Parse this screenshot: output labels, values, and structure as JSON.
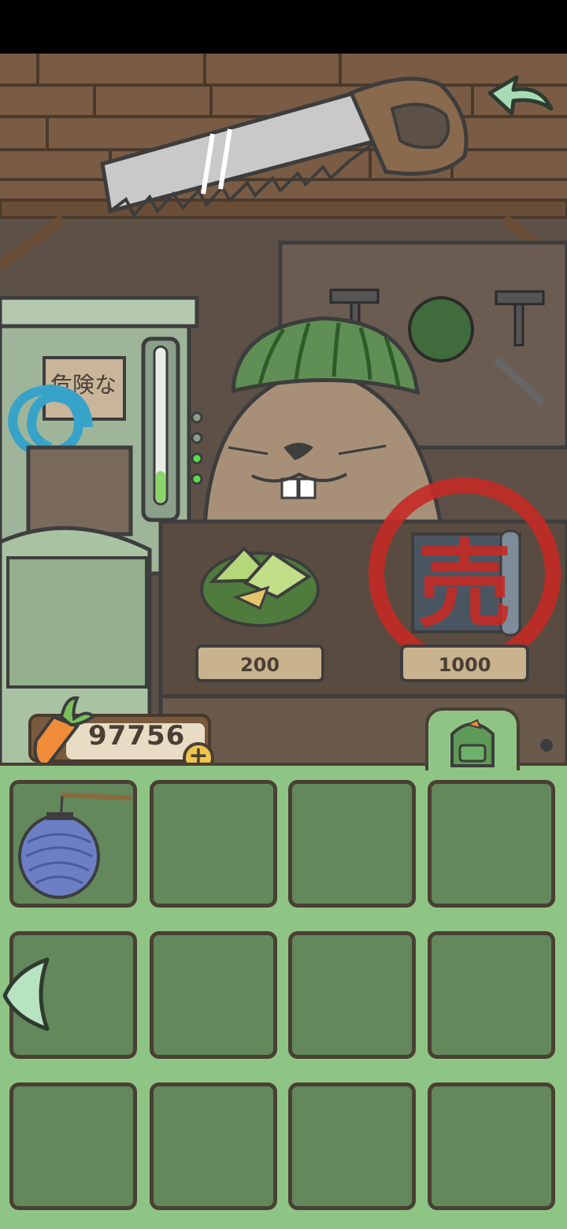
{
  "shop": {
    "items": [
      {
        "name": "zongzi",
        "price": "200",
        "sold": false
      },
      {
        "name": "blueprint",
        "price": "1000",
        "sold": true,
        "sold_stamp": "売"
      }
    ],
    "sign_text": "危険な"
  },
  "currency": {
    "icon": "carrot-icon",
    "amount": "97756"
  },
  "inventory": {
    "slots": [
      {
        "item": "paper-lantern"
      },
      {
        "item": null
      },
      {
        "item": null
      },
      {
        "item": null
      },
      {
        "item": null
      },
      {
        "item": null
      },
      {
        "item": null
      },
      {
        "item": null
      },
      {
        "item": null
      },
      {
        "item": null
      },
      {
        "item": null
      },
      {
        "item": null
      }
    ]
  },
  "colors": {
    "panel": "#8fc584",
    "slot": "#62885c",
    "outline": "#4a3f35",
    "stamp": "#c42a25",
    "plus": "#f0c44c"
  }
}
